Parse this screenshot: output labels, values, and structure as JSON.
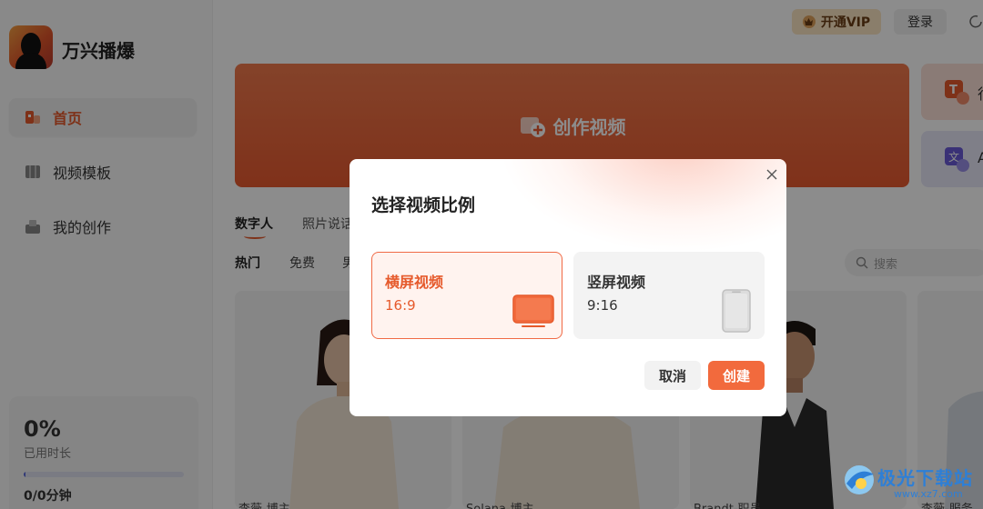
{
  "app": {
    "name": "万兴播爆"
  },
  "sidebar": {
    "items": [
      {
        "label": "首页",
        "icon": "home-icon",
        "active": true
      },
      {
        "label": "视频模板",
        "icon": "video-template-icon",
        "active": false
      },
      {
        "label": "我的创作",
        "icon": "my-creations-icon",
        "active": false
      }
    ],
    "usage": {
      "percent": "0%",
      "label": "已用时长",
      "minutes": "0/0分钟",
      "progress": 0.01
    }
  },
  "header": {
    "vip_label": "开通VIP",
    "login_label": "登录"
  },
  "banner": {
    "label": "创作视频"
  },
  "side_cards": [
    {
      "letter": "行",
      "icon": "translate-text-icon"
    },
    {
      "letter": "A",
      "icon": "ai-translate-icon"
    }
  ],
  "tabs": [
    {
      "label": "数字人",
      "active": true
    },
    {
      "label": "照片说话",
      "active": false
    }
  ],
  "subtabs": [
    {
      "label": "热门",
      "active": true
    },
    {
      "label": "免费",
      "active": false
    },
    {
      "label": "男",
      "active": false
    }
  ],
  "search": {
    "placeholder": "搜索"
  },
  "cards": [
    {
      "name": "李薇-博主"
    },
    {
      "name": "Solana-博主"
    },
    {
      "name": "Brandt-职员"
    },
    {
      "name": "李薇-服务"
    }
  ],
  "dialog": {
    "title": "选择视频比例",
    "options": [
      {
        "title": "横屏视频",
        "ratio": "16:9",
        "selected": true
      },
      {
        "title": "竖屏视频",
        "ratio": "9:16",
        "selected": false
      }
    ],
    "cancel_label": "取消",
    "create_label": "创建"
  },
  "watermark": {
    "title": "极光下载站",
    "url": "www.xz7.com"
  },
  "colors": {
    "accent": "#e65a2c",
    "accent_button": "#f26a3d",
    "vip_bg": "#fbe5c4",
    "progress": "#5667d8"
  }
}
